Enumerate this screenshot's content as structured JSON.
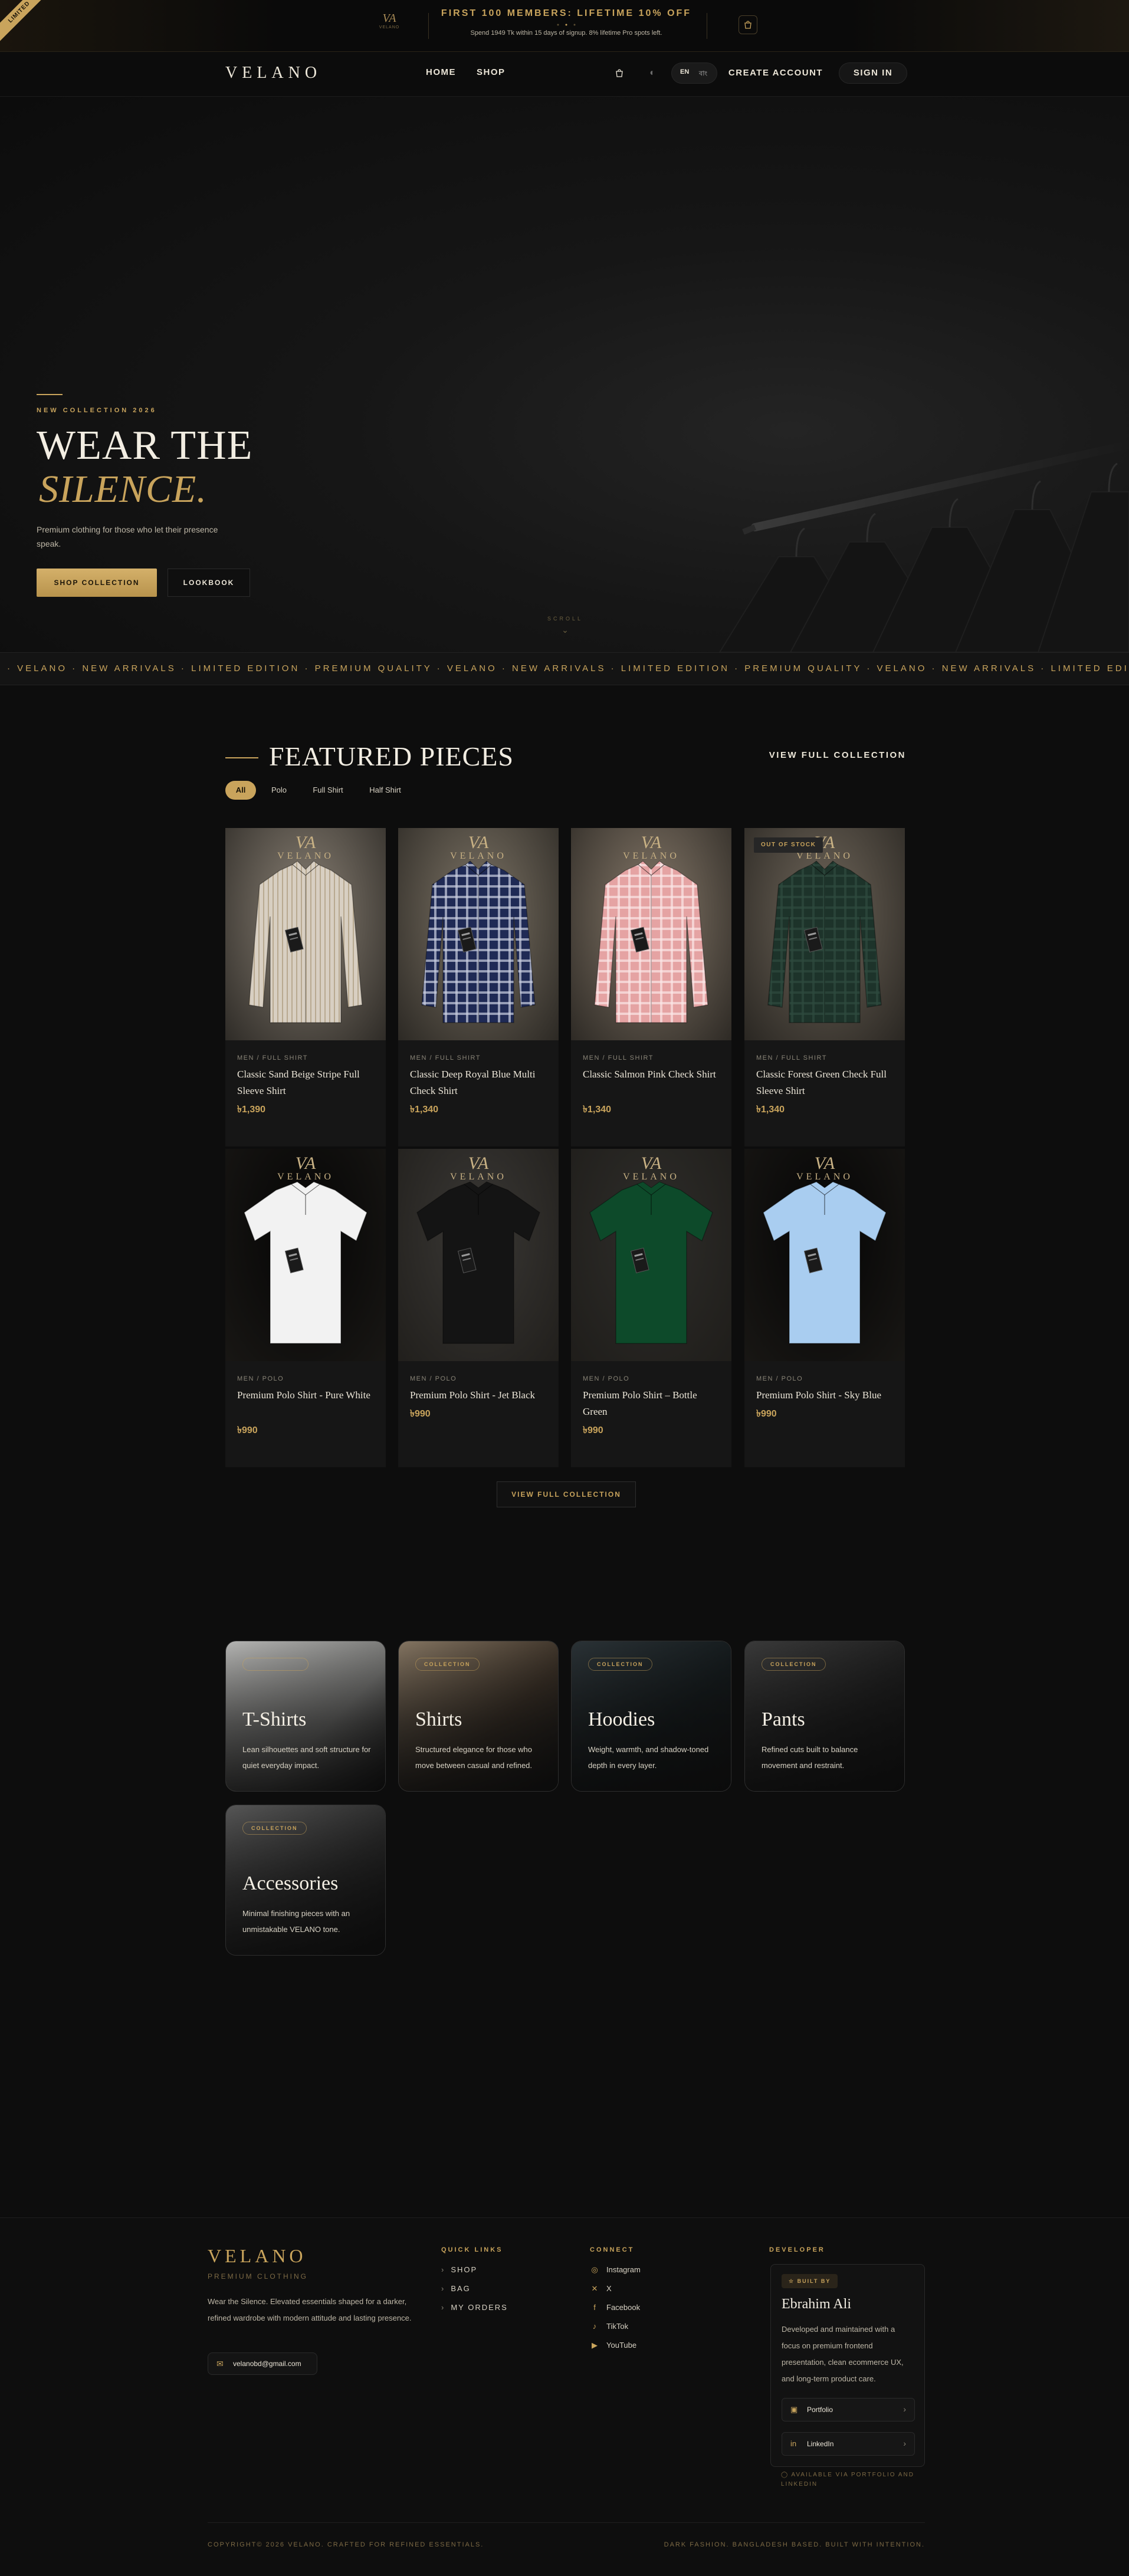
{
  "promo": {
    "ribbon": "LIMITED",
    "logo_monogram": "VA",
    "logo_text": "VELANO",
    "title": "FIRST 100 MEMBERS: LIFETIME 10% OFF",
    "subtitle": "Spend 1949 Tk within 15 days of signup. 8% lifetime Pro spots left.",
    "bag_icon": "shopping-bag-icon"
  },
  "nav": {
    "brand": "VELANO",
    "links": [
      "HOME",
      "SHOP"
    ],
    "lang_en": "EN",
    "lang_bn": "বাং",
    "create_account": "CREATE ACCOUNT",
    "sign_in": "SIGN IN"
  },
  "hero": {
    "eyebrow": "NEW COLLECTION 2026",
    "title_line1": "WEAR THE",
    "title_line2": "SILENCE.",
    "description": "Premium clothing for those who let their presence speak.",
    "cta_primary": "SHOP COLLECTION",
    "cta_secondary": "LOOKBOOK",
    "scroll_label": "SCROLL",
    "scroll_chevron": "⌄"
  },
  "marquee": {
    "text": "· VELANO · NEW ARRIVALS · LIMITED EDITION ·  PREMIUM QUALITY · VELANO · NEW ARRIVALS · LIMITED EDITION ·  PREMIUM QUALITY · VELANO · NEW ARRIVALS · LIMITED EDITION ·"
  },
  "featured": {
    "title": "FEATURED PIECES",
    "view_link": "VIEW FULL COLLECTION",
    "filters": [
      "All",
      "Polo",
      "Full Shirt",
      "Half Shirt"
    ],
    "active_filter": "All",
    "watermark_monogram": "VA",
    "watermark_text": "VELANO",
    "out_of_stock_label": "OUT OF STOCK",
    "products": [
      {
        "category": "MEN / FULL SHIRT",
        "name": "Classic Sand Beige Stripe Full Sleeve Shirt",
        "price": "৳1,390",
        "color": "#d8cfc2",
        "bg": "#8a8175",
        "pattern": "stripe",
        "out_of_stock": false
      },
      {
        "category": "MEN / FULL SHIRT",
        "name": "Classic Deep Royal Blue Multi Check Shirt",
        "price": "৳1,340",
        "color": "#1f2a55",
        "bg": "#7d7466",
        "pattern": "check",
        "out_of_stock": false
      },
      {
        "category": "MEN / FULL SHIRT",
        "name": "Classic Salmon Pink Check Shirt",
        "price": "৳1,340",
        "color": "#e5a3a3",
        "bg": "#86796a",
        "pattern": "check",
        "out_of_stock": false
      },
      {
        "category": "MEN / FULL SHIRT",
        "name": "Classic Forest Green Check Full Sleeve Shirt",
        "price": "৳1,340",
        "color": "#1d332a",
        "bg": "#6f665a",
        "pattern": "check",
        "out_of_stock": true
      },
      {
        "category": "MEN / POLO",
        "name": "Premium Polo Shirt - Pure White",
        "price": "৳990",
        "color": "#f2f2f2",
        "bg": "#050505",
        "pattern": "polo",
        "out_of_stock": false
      },
      {
        "category": "MEN / POLO",
        "name": "Premium Polo Shirt - Jet Black",
        "price": "৳990",
        "color": "#141414",
        "bg": "#3a3835",
        "pattern": "polo",
        "out_of_stock": false
      },
      {
        "category": "MEN / POLO",
        "name": "Premium Polo Shirt – Bottle Green",
        "price": "৳990",
        "color": "#0d4a2a",
        "bg": "#2e2d2a",
        "pattern": "polo",
        "out_of_stock": false
      },
      {
        "category": "MEN / POLO",
        "name": "Premium Polo Shirt - Sky Blue",
        "price": "৳990",
        "color": "#a9cdf0",
        "bg": "#050505",
        "pattern": "polo",
        "out_of_stock": false
      }
    ],
    "view_full_button": "VIEW FULL COLLECTION"
  },
  "categories": [
    {
      "pill": "",
      "name": "T-Shirts",
      "description": "Lean silhouettes and soft structure for quiet everyday impact.",
      "bg": "#7a7a78",
      "bg2": "#bdbdbb"
    },
    {
      "pill": "COLLECTION",
      "name": "Shirts",
      "description": "Structured elegance for those who move between casual and refined.",
      "bg": "#3a3026",
      "bg2": "#8a7a66"
    },
    {
      "pill": "COLLECTION",
      "name": "Hoodies",
      "description": "Weight, warmth, and shadow-toned depth in every layer.",
      "bg": "#141a1c",
      "bg2": "#2c3438"
    },
    {
      "pill": "COLLECTION",
      "name": "Pants",
      "description": "Refined cuts built to balance movement and restraint.",
      "bg": "#1e1e1e",
      "bg2": "#3c3c3c"
    },
    {
      "pill": "COLLECTION",
      "name": "Accessories",
      "description": "Minimal finishing pieces with an unmistakable VELANO tone.",
      "bg": "#2a2a2a",
      "bg2": "#5a5a5a"
    }
  ],
  "footer": {
    "brand": "VELANO",
    "tagline": "PREMIUM CLOTHING",
    "description": "Wear the Silence. Elevated essentials shaped for a darker, refined wardrobe with modern attitude and lasting presence.",
    "email": "velanobd@gmail.com",
    "quick_links_heading": "QUICK LINKS",
    "quick_links": [
      "SHOP",
      "BAG",
      "MY ORDERS"
    ],
    "connect_heading": "CONNECT",
    "socials": [
      {
        "icon": "instagram-icon",
        "glyph": "◎",
        "label": "Instagram"
      },
      {
        "icon": "x-icon",
        "glyph": "✕",
        "label": "X"
      },
      {
        "icon": "facebook-icon",
        "glyph": "f",
        "label": "Facebook"
      },
      {
        "icon": "tiktok-icon",
        "glyph": "♪",
        "label": "TikTok"
      },
      {
        "icon": "youtube-icon",
        "glyph": "▶",
        "label": "YouTube"
      }
    ],
    "developer_heading": "DEVELOPER",
    "dev_badge": "BUILT BY",
    "dev_name": "Ebrahim Ali",
    "dev_description": "Developed and maintained with a focus on premium frontend presentation, clean ecommerce UX, and long-term product care.",
    "dev_links": [
      "Portfolio",
      "LinkedIn"
    ],
    "dev_footer": "AVAILABLE VIA PORTFOLIO AND LINKEDIN",
    "copyright": "COPYRIGHT© 2026 VELANO. CRAFTED FOR REFINED ESSENTIALS.",
    "made_in": "DARK FASHION. BANGLADESH BASED. BUILT WITH INTENTION."
  }
}
